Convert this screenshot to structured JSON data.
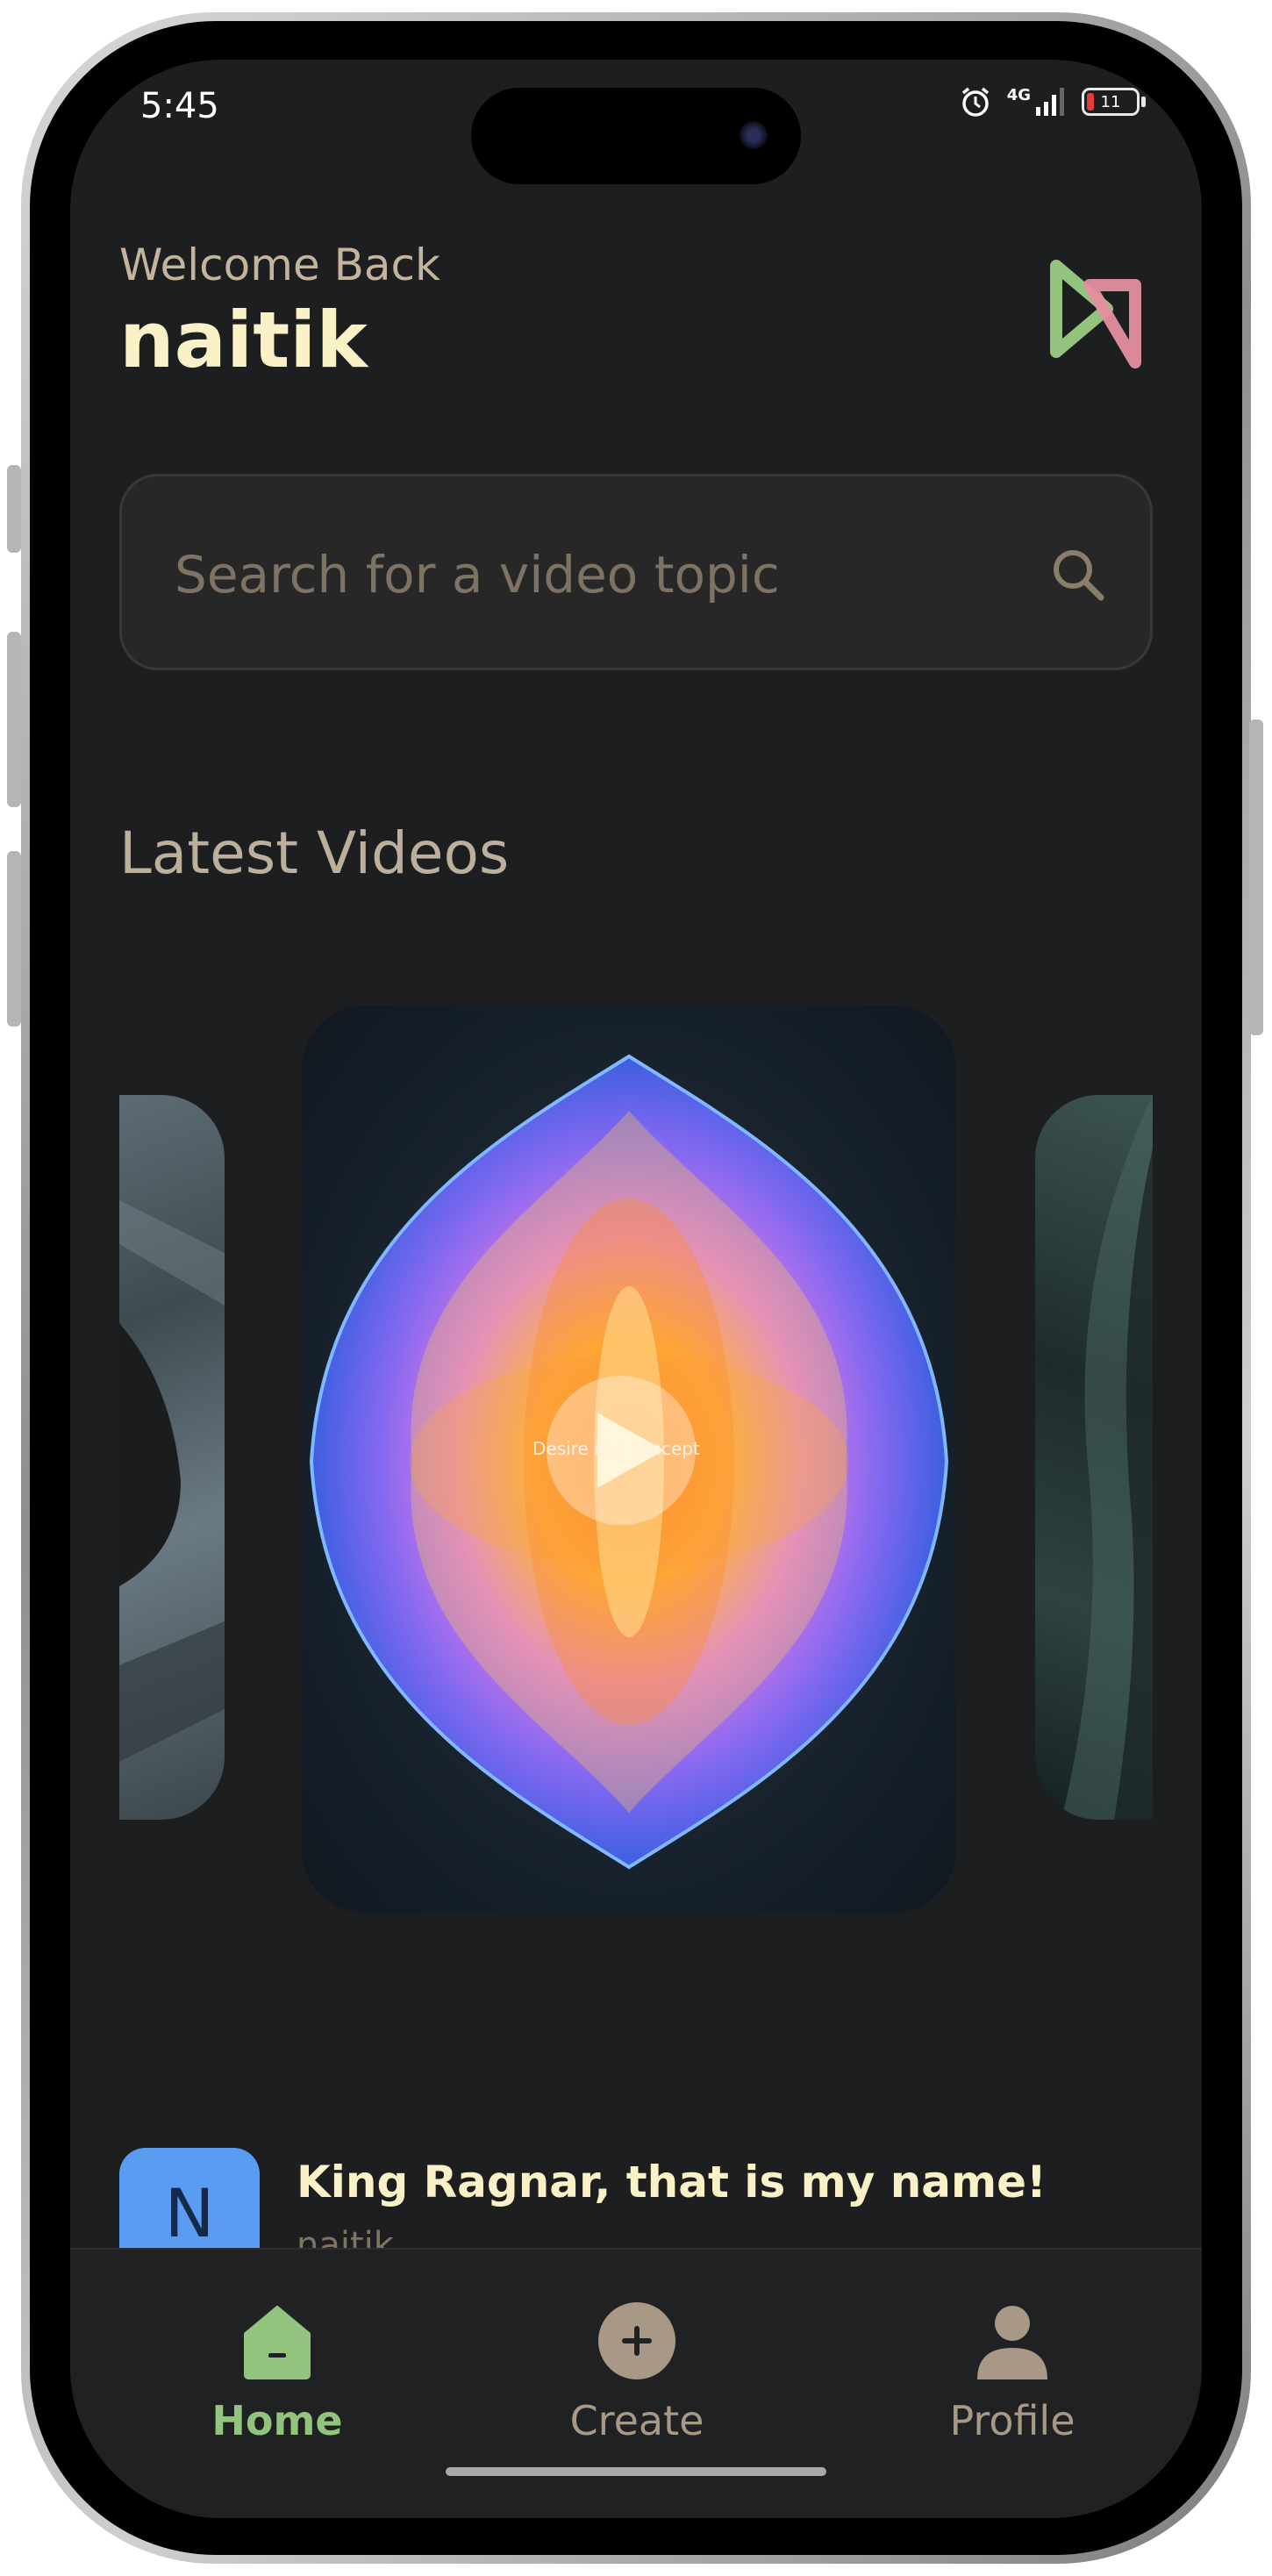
{
  "status_bar": {
    "time": "5:45",
    "network": "4G",
    "battery": "11"
  },
  "header": {
    "welcome": "Welcome Back",
    "username": "naitik"
  },
  "search": {
    "placeholder": "Search for a video topic"
  },
  "latest": {
    "title": "Latest Videos",
    "overlay_text": "Desire is a concept"
  },
  "video_row": {
    "avatar_letter": "N",
    "title": "King Ragnar, that is my name!",
    "creator": "naitik"
  },
  "tabs": [
    {
      "label": "Home",
      "color": "#93c47d",
      "icon": "home-icon"
    },
    {
      "label": "Create",
      "color": "#a89886",
      "icon": "plus-circle-icon"
    },
    {
      "label": "Profile",
      "color": "#a89886",
      "icon": "user-icon"
    }
  ],
  "colors": {
    "accent_green": "#93c47d",
    "accent_pink": "#e58fa0",
    "cream": "#fbf1c7",
    "background": "#1c1e1f"
  }
}
